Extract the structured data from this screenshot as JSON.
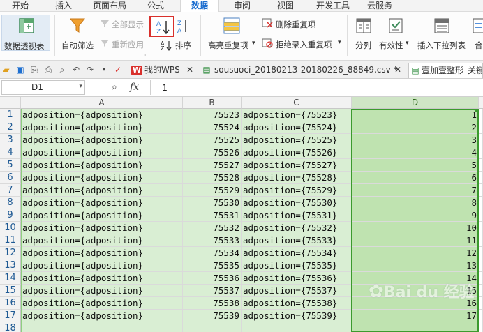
{
  "menu": {
    "tabs": [
      "开始",
      "插入",
      "页面布局",
      "公式",
      "数据",
      "审阅",
      "视图",
      "开发工具",
      "云服务"
    ],
    "active": "数据"
  },
  "ribbon": {
    "pivot": "数据透视表",
    "autofilter": "自动筛选",
    "show_all": "全部显示",
    "reapply": "重新应用",
    "sort": "排序",
    "highlight_dup": "高亮重复项",
    "remove_dup": "删除重复项",
    "reject_dup": "拒绝录入重复项",
    "split": "分列",
    "validity": "有效性",
    "insert_dropdown": "插入下拉列表",
    "combine": "合"
  },
  "docbar": {
    "tab1": "我的WPS",
    "tab2": "sousuoci_20180213-20180226_88849.csv *",
    "tab3": "壹加壹整形_关键"
  },
  "formula": {
    "cell_ref": "D1",
    "fx": "fx",
    "value": "1"
  },
  "grid": {
    "columns": [
      "A",
      "B",
      "C",
      "D"
    ],
    "rows": [
      {
        "n": "1",
        "a": "adposition={adposition}",
        "b": "75523",
        "c": "adposition={75523}",
        "d": "1"
      },
      {
        "n": "2",
        "a": "adposition={adposition}",
        "b": "75524",
        "c": "adposition={75524}",
        "d": "2"
      },
      {
        "n": "3",
        "a": "adposition={adposition}",
        "b": "75525",
        "c": "adposition={75525}",
        "d": "3"
      },
      {
        "n": "4",
        "a": "adposition={adposition}",
        "b": "75526",
        "c": "adposition={75526}",
        "d": "4"
      },
      {
        "n": "5",
        "a": "adposition={adposition}",
        "b": "75527",
        "c": "adposition={75527}",
        "d": "5"
      },
      {
        "n": "6",
        "a": "adposition={adposition}",
        "b": "75528",
        "c": "adposition={75528}",
        "d": "6"
      },
      {
        "n": "7",
        "a": "adposition={adposition}",
        "b": "75529",
        "c": "adposition={75529}",
        "d": "7"
      },
      {
        "n": "8",
        "a": "adposition={adposition}",
        "b": "75530",
        "c": "adposition={75530}",
        "d": "8"
      },
      {
        "n": "9",
        "a": "adposition={adposition}",
        "b": "75531",
        "c": "adposition={75531}",
        "d": "9"
      },
      {
        "n": "10",
        "a": "adposition={adposition}",
        "b": "75532",
        "c": "adposition={75532}",
        "d": "10"
      },
      {
        "n": "11",
        "a": "adposition={adposition}",
        "b": "75533",
        "c": "adposition={75533}",
        "d": "11"
      },
      {
        "n": "12",
        "a": "adposition={adposition}",
        "b": "75534",
        "c": "adposition={75534}",
        "d": "12"
      },
      {
        "n": "13",
        "a": "adposition={adposition}",
        "b": "75535",
        "c": "adposition={75535}",
        "d": "13"
      },
      {
        "n": "14",
        "a": "adposition={adposition}",
        "b": "75536",
        "c": "adposition={75536}",
        "d": "14"
      },
      {
        "n": "15",
        "a": "adposition={adposition}",
        "b": "75537",
        "c": "adposition={75537}",
        "d": "15"
      },
      {
        "n": "16",
        "a": "adposition={adposition}",
        "b": "75538",
        "c": "adposition={75538}",
        "d": "16"
      },
      {
        "n": "17",
        "a": "adposition={adposition}",
        "b": "75539",
        "c": "adposition={75539}",
        "d": "17"
      },
      {
        "n": "18",
        "a": "",
        "b": "",
        "c": "",
        "d": ""
      }
    ]
  },
  "watermark": "Bai du 经验",
  "colors": {
    "accent": "#1e6fd0",
    "selection_green": "#d9eed3",
    "selected_column": "#bfe3b0",
    "highlight_box": "#d9302c"
  }
}
